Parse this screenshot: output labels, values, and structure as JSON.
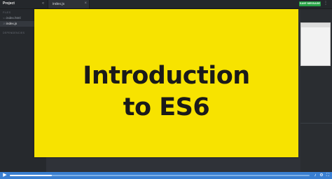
{
  "app": {
    "project_title": "Project",
    "sidebar_toggle_icon": "«"
  },
  "tabs": [
    {
      "label": "index.js",
      "close_icon": "×"
    }
  ],
  "toolbar": {
    "save_label": "SAVE MESSAGE",
    "save_color": "#25a244",
    "more_icon": "⋮"
  },
  "sidebar": {
    "files_label": "FILES",
    "files": [
      {
        "name": "index.html",
        "icon": "<>"
      },
      {
        "name": "index.js",
        "icon": "JS"
      }
    ],
    "dependencies_label": "DEPENDENCIES"
  },
  "slide": {
    "title": "Introduction\nto ES6",
    "background": "#f7e300"
  },
  "player": {
    "play_icon": "▶",
    "volume_icon": "♪",
    "settings_icon": "⚙",
    "fullscreen_icon": "⛶",
    "progress": 0.14,
    "accent": "#3a7fd1"
  }
}
